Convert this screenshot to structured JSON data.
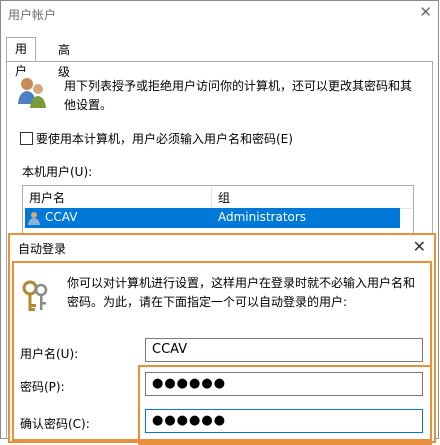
{
  "window": {
    "title": "用户帐户",
    "close_glyph": "✕"
  },
  "tabs": [
    {
      "label": "用户"
    },
    {
      "label": "高级"
    }
  ],
  "main": {
    "description": "用下列表授予或拒绝用户访问你的计算机，还可以更改其密码和其他设置。",
    "checkbox_label": "要使用本计算机，用户必须输入用户名和密码(E)",
    "checkbox_checked": false,
    "local_users_label": "本机用户(U):",
    "columns": [
      "用户名",
      "组"
    ],
    "rows": [
      {
        "user": "CCAV",
        "group": "Administrators",
        "selected": true
      }
    ]
  },
  "dialog": {
    "title": "自动登录",
    "close_glyph": "✕",
    "description": "你可以对计算机进行设置，这样用户在登录时就不必输入用户名和密码。为此，请在下面指定一个可以自动登录的用户:",
    "username_label": "用户名(U):",
    "username_value": "CCAV",
    "password_label": "密码(P):",
    "password_value": "●●●●●●",
    "confirm_label": "确认密码(C):",
    "confirm_value": "●●●●●●"
  },
  "colors": {
    "highlight_border": "#e8913a",
    "selection": "#0078d7"
  },
  "icons": {
    "users": "users-icon",
    "keys": "keys-icon"
  }
}
